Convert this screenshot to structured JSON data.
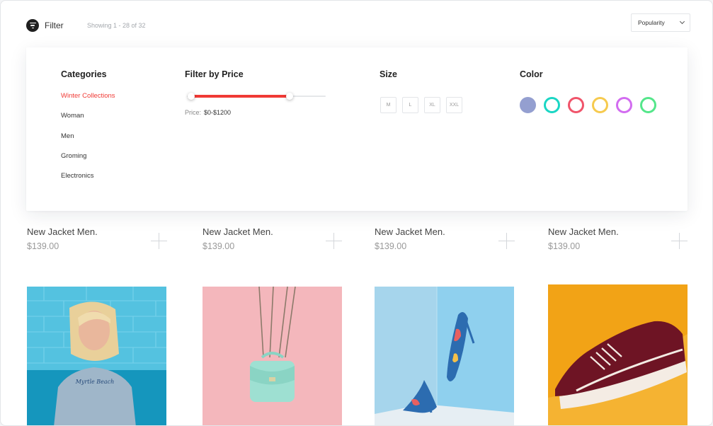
{
  "toolbar": {
    "filter_label": "Filter",
    "showing_text": "Showing 1 - 28 of 32",
    "sort_value": "Popularity"
  },
  "filters": {
    "categories_title": "Categories",
    "categories": [
      "Winter Collections",
      "Woman",
      "Men",
      "Groming",
      "Electronics"
    ],
    "active_category": "Winter Collections",
    "price_title": "Filter by Price",
    "price_prefix": "Price:",
    "price_value": "$0-$1200",
    "price_range_fraction": [
      0.03,
      0.74
    ],
    "size_title": "Size",
    "sizes": [
      "M",
      "L",
      "XL",
      "XXL"
    ],
    "color_title": "Color",
    "colors": [
      {
        "name": "lavender",
        "hex": "#949fd0",
        "filled": true
      },
      {
        "name": "teal",
        "hex": "#1ad6c4",
        "filled": false
      },
      {
        "name": "coral",
        "hex": "#f0546a",
        "filled": false
      },
      {
        "name": "yellow",
        "hex": "#f6ca4e",
        "filled": false
      },
      {
        "name": "violet",
        "hex": "#d26cf0",
        "filled": false
      },
      {
        "name": "green",
        "hex": "#54e68a",
        "filled": false
      }
    ]
  },
  "products_row1": [
    {
      "name": "New Jacket Men.",
      "price": "$139.00"
    },
    {
      "name": "New Jacket Men.",
      "price": "$139.00"
    },
    {
      "name": "New Jacket Men.",
      "price": "$139.00"
    },
    {
      "name": "New Jacket Men.",
      "price": "$139.00"
    }
  ],
  "products_row2": [
    {
      "image": "woman-in-blue-sweatshirt",
      "sweatshirt_text": "Myrtle Beach"
    },
    {
      "image": "mint-handbag-on-pink"
    },
    {
      "image": "floral-high-heels"
    },
    {
      "image": "burgundy-sneaker-on-yellow"
    }
  ],
  "accent_color": "#f03a35"
}
